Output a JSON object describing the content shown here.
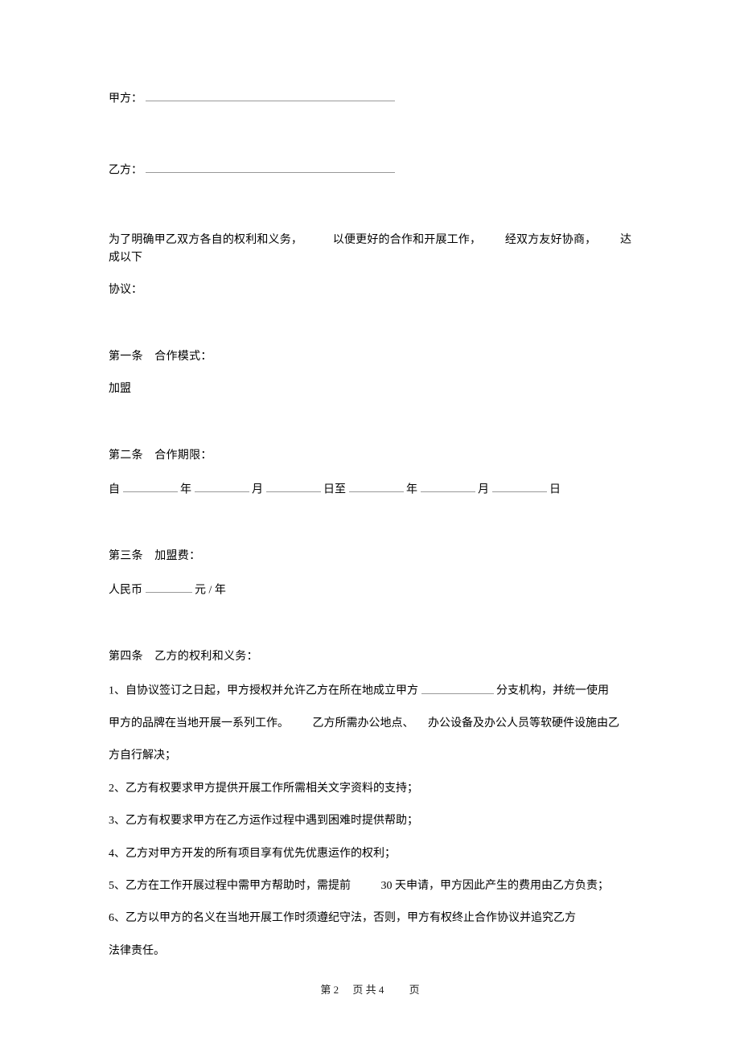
{
  "party_a_label": "甲方：",
  "party_b_label": "乙方：",
  "preamble_seg1": "为了明确甲乙双方各自的权利和义务，",
  "preamble_seg2": "以便更好的合作和开展工作，",
  "preamble_seg3": "经双方友好协商，",
  "preamble_seg4": "达成以下",
  "preamble_line2": "协议：",
  "art1_title": "第一条　合作模式：",
  "art1_body": "加盟",
  "art2_title": "第二条　合作期限：",
  "art2_from": "自",
  "art2_year": "年",
  "art2_month": "月",
  "art2_day_to": "日至",
  "art2_year2": "年",
  "art2_month2": "月",
  "art2_day2": "日",
  "art3_title": "第三条　加盟费：",
  "art3_rmb": "人民币",
  "art3_unit": "元 / 年",
  "art4_title": "第四条　乙方的权利和义务：",
  "art4_1a": "1、自协议签订之日起，甲方授权并允许乙方在所在地成立甲方",
  "art4_1b": "分支机构，并统一使用",
  "art4_1c_seg1": "甲方的品牌在当地开展一系列工作。",
  "art4_1c_seg2": "乙方所需办公地点、",
  "art4_1c_seg3": "办公设备及办公人员等软硬件设施由乙",
  "art4_1d": "方自行解决；",
  "art4_2": "2、乙方有权要求甲方提供开展工作所需相关文字资料的支持；",
  "art4_3": "3、乙方有权要求甲方在乙方运作过程中遇到困难时提供帮助；",
  "art4_4": "4、乙方对甲方开发的所有项目享有优先优惠运作的权利；",
  "art4_5a": "5、乙方在工作开展过程中需甲方帮助时，需提前",
  "art4_5b": "30 天申请，甲方因此产生的费用由乙方负责；",
  "art4_6a": "6、乙方以甲方的名义在当地开展工作时须遵纪守法，否则，甲方有权终止合作协议并追究乙方",
  "art4_6b": "法律责任。",
  "footer_seg1": "第 2",
  "footer_seg2": "页 共 4",
  "footer_seg3": "页"
}
